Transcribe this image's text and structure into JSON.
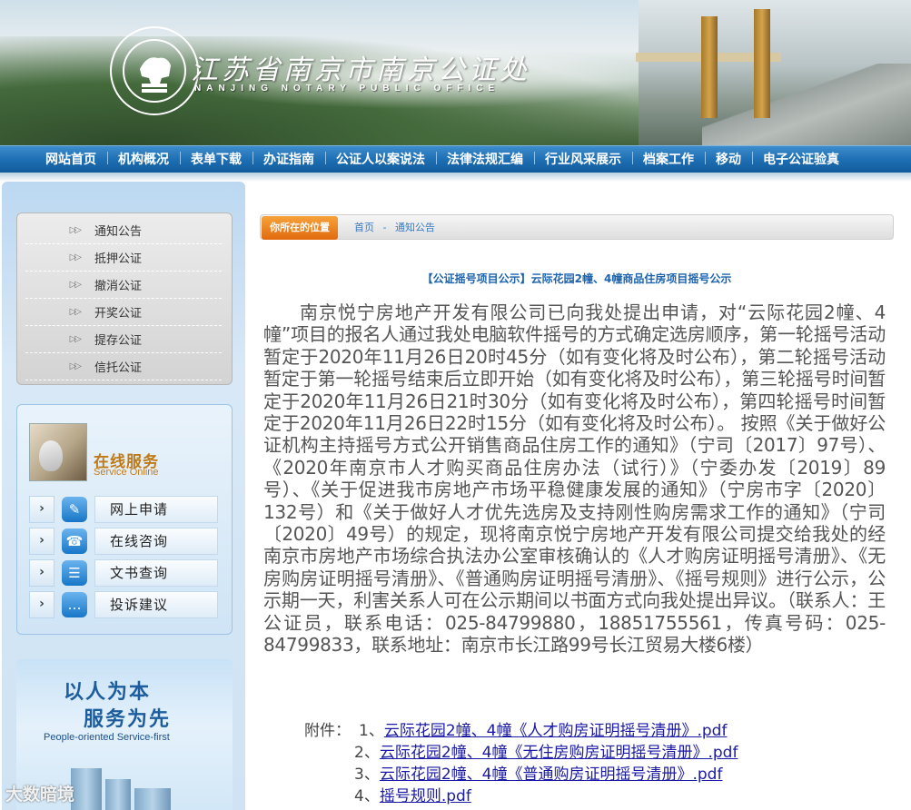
{
  "header": {
    "title": "江苏省南京市南京公证处",
    "subtitle": "NANJING NOTARY PUBLIC OFFICE",
    "emblem_text": "南京公证处 NANJING NOTARY PUBLIC OFFICE"
  },
  "nav": {
    "items": [
      "网站首页",
      "机构概况",
      "表单下载",
      "办证指南",
      "公证人以案说法",
      "法律法规汇编",
      "行业风采展示",
      "档案工作",
      "移动",
      "电子公证验真"
    ]
  },
  "sidebar": {
    "menu": [
      "通知公告",
      "抵押公证",
      "撤消公证",
      "开奖公证",
      "提存公证",
      "信托公证"
    ],
    "online": {
      "title": "在线服务",
      "subtitle": "Service Online",
      "items": [
        {
          "label": "网上申请",
          "icon": "pen-icon"
        },
        {
          "label": "在线咨询",
          "icon": "headset-icon"
        },
        {
          "label": "文书查询",
          "icon": "list-icon"
        },
        {
          "label": "投诉建议",
          "icon": "chat-icon"
        }
      ]
    },
    "promo": {
      "line1": "以人为本",
      "line2": "服务为先",
      "english": "People-oriented  Service-first"
    },
    "watermark": "大数暗境"
  },
  "breadcrumb": {
    "label": "你所在的位置",
    "items": [
      "首页",
      "-",
      "通知公告"
    ]
  },
  "article": {
    "title": "【公证摇号项目公示】云际花园2幢、4幢商品住房项目摇号公示",
    "body": "南京悦宁房地产开发有限公司已向我处提出申请，对“云际花园2幢、4幢”项目的报名人通过我处电脑软件摇号的方式确定选房顺序，第一轮摇号活动暂定于2020年11月26日20时45分（如有变化将及时公布），第二轮摇号活动暂定于第一轮摇号结束后立即开始（如有变化将及时公布），第三轮摇号时间暂定于2020年11月26日21时30分（如有变化将及时公布），第四轮摇号时间暂定于2020年11月26日22时15分（如有变化将及时公布）。  按照《关于做好公证机构主持摇号方式公开销售商品住房工作的通知》（宁司〔2017〕97号）、《2020年南京市人才购买商品住房办法（试行）》（宁委办发〔2019〕89号）、《关于促进我市房地产市场平稳健康发展的通知》（宁房市字〔2020〕132号）和《关于做好人才优先选房及支持刚性购房需求工作的通知》（宁司〔2020〕49号）的规定，现将南京悦宁房地产开发有限公司提交给我处的经南京市房地产市场综合执法办公室审核确认的《人才购房证明摇号清册》、《无房购房证明摇号清册》、《普通购房证明摇号清册》、《摇号规则》进行公示，公示期一天，利害关系人可在公示期间以书面方式向我处提出异议。（联系人：王公证员，联系电话：025-84799880，18851755561，传真号码：025-84799833，联系地址：南京市长江路99号长江贸易大楼6楼）",
    "attachments_label": "附件：",
    "attachments": [
      {
        "num": "1、",
        "name": "云际花园2幢、4幢《人才购房证明摇号清册》.pdf"
      },
      {
        "num": "2、",
        "name": "云际花园2幢、4幢《无住房购房证明摇号清册》.pdf"
      },
      {
        "num": "3、",
        "name": "云际花园2幢、4幢《普通购房证明摇号清册》.pdf"
      },
      {
        "num": "4、",
        "name": "摇号规则.pdf"
      }
    ]
  }
}
